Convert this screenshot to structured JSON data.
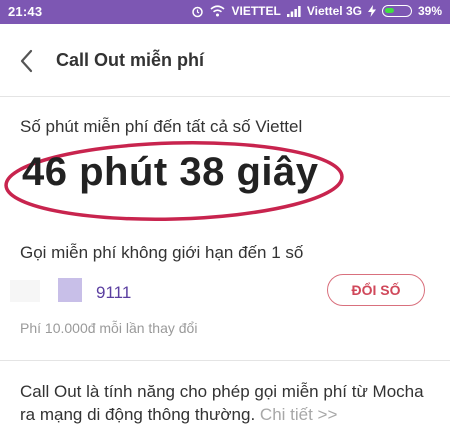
{
  "status_bar": {
    "time": "21:43",
    "carrier1": "VIETTEL",
    "carrier2": "Viettel 3G",
    "battery": "39%",
    "battery_level": 0.39
  },
  "header": {
    "title": "Call Out miễn phí"
  },
  "free_minutes": {
    "label": "Số phút miễn phí đến tất cả số Viettel",
    "value": "46 phút 38 giây"
  },
  "unlimited": {
    "label": "Gọi miễn phí không giới hạn đến 1 số",
    "number": "9111",
    "change_button": "ĐỔI SỐ",
    "fee_note": "Phí 10.000đ mỗi lần thay đổi"
  },
  "description": {
    "text": "Call Out là tính năng cho phép gọi miễn phí từ Mocha ra mạng di động thông thường.",
    "link": "Chi tiết >>"
  },
  "colors": {
    "status_bar": "#7d57b3",
    "accent": "#d0485a",
    "number": "#5b3fa0",
    "highlight_ellipse": "#c8244e"
  }
}
